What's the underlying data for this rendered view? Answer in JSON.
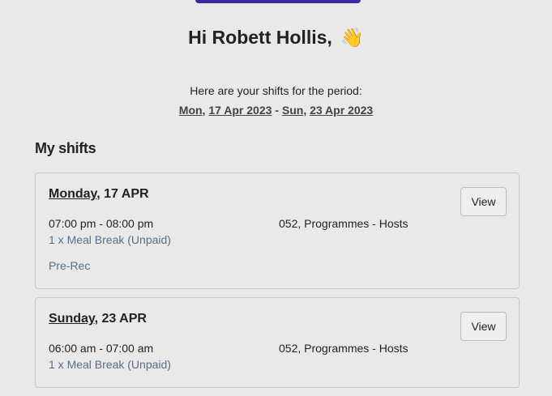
{
  "greeting": {
    "text": "Hi Robett Hollis,",
    "emoji": "👋"
  },
  "period": {
    "intro": "Here are your shifts for the period:",
    "start_day": "Mon",
    "start_date": "17 Apr 2023",
    "separator": "-",
    "end_day": "Sun",
    "end_date": "23 Apr 2023"
  },
  "section": {
    "title": "My shifts"
  },
  "shifts": [
    {
      "day": "Monday",
      "date": "17 APR",
      "time": "07:00 pm - 08:00 pm",
      "break": "1 x Meal Break (Unpaid)",
      "location": "052, Programmes - Hosts",
      "tag": "Pre-Rec",
      "view_label": "View"
    },
    {
      "day": "Sunday",
      "date": "23 APR",
      "time": "06:00 am - 07:00 am",
      "break": "1 x Meal Break (Unpaid)",
      "location": "052, Programmes - Hosts",
      "view_label": "View"
    }
  ],
  "colors": {
    "background": "#e8e9e8",
    "accent_bar": "#3b2aa0",
    "muted_text": "#5b6e87"
  }
}
